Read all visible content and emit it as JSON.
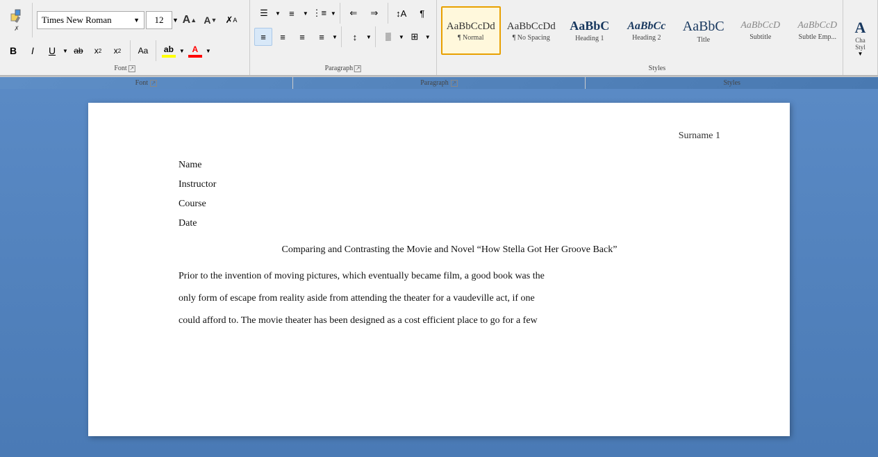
{
  "ribbon": {
    "font": {
      "name": "Times New Roman",
      "size": "12",
      "grow_label": "A",
      "shrink_label": "A",
      "clear_label": "✗"
    },
    "format": {
      "bold": "B",
      "italic": "I",
      "underline": "U",
      "strikethrough": "ab",
      "subscript": "x",
      "superscript": "x",
      "case": "Aa"
    },
    "paragraph_label": "Paragraph",
    "font_label": "Font",
    "styles_label": "Styles"
  },
  "styles": [
    {
      "id": "normal",
      "preview": "AaBbCcDd",
      "label": "¶ Normal",
      "active": true
    },
    {
      "id": "no-spacing",
      "preview": "AaBbCcDd",
      "label": "¶ No Spacing",
      "active": false
    },
    {
      "id": "heading1",
      "preview": "AaBbC",
      "label": "Heading 1",
      "active": false
    },
    {
      "id": "heading2",
      "preview": "AaBbCc",
      "label": "Heading 2",
      "active": false
    },
    {
      "id": "title",
      "preview": "AaBbC",
      "label": "Title",
      "active": false
    },
    {
      "id": "subtitle",
      "preview": "AaBbCcD",
      "label": "Subtitle",
      "active": false
    },
    {
      "id": "subtle-emphasis",
      "preview": "AaBbCcD",
      "label": "Subtle Emp...",
      "active": false
    },
    {
      "id": "change-styles",
      "preview": "A",
      "label": "Cha Styl",
      "active": false
    }
  ],
  "document": {
    "surname_page": "Surname 1",
    "name_label": "Name",
    "instructor_label": "Instructor",
    "course_label": "Course",
    "date_label": "Date",
    "title": "Comparing and Contrasting the Movie and Novel “How Stella Got Her Groove Back”",
    "paragraph1": "Prior to the invention of moving pictures, which eventually became film, a good book was the",
    "paragraph2": "only form of escape from reality aside from attending the theater for a vaudeville act, if one",
    "paragraph3": "could afford to. The movie theater has been designed as a cost efficient place to go for a few"
  }
}
